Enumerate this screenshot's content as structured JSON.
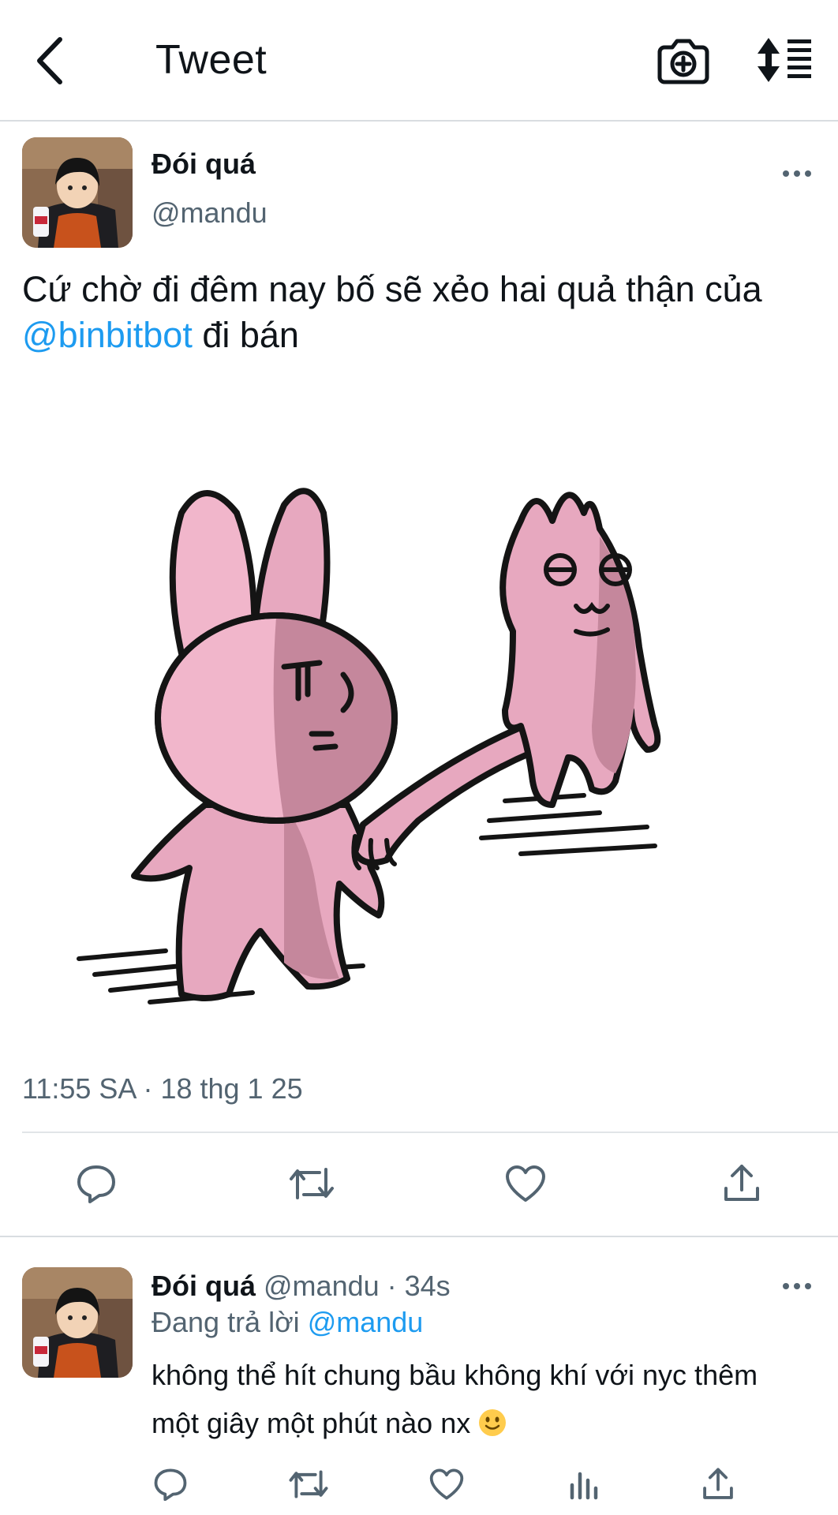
{
  "header": {
    "back_icon": "chevron-left-icon",
    "title": "Tweet",
    "camera_icon": "camera-plus-icon",
    "sort_icon": "sort-list-icon"
  },
  "tweet": {
    "author_name": "Đói quá",
    "handle": "@mandu",
    "text_before": "Cứ chờ đi đêm nay bố sẽ xẻo hai quả thận của ",
    "mention": "@binbitbot",
    "text_after": " đi bán",
    "timestamp": "11:55 SA · 18 thg 1 25",
    "actions": [
      "reply-icon",
      "retweet-icon",
      "like-icon",
      "share-icon"
    ]
  },
  "reply": {
    "author_name": "Đói quá",
    "handle_time": "@mandu · 34s",
    "replying_label": "Đang trả lời ",
    "replying_to": "@mandu",
    "text": "không thể hít chung bầu không khí với nyc thêm một giây một phút nào nx",
    "emoji": "slightly-smiling-face-emoji",
    "actions": [
      "reply-icon",
      "retweet-icon",
      "like-icon",
      "analytics-icon",
      "share-icon"
    ]
  },
  "colors": {
    "link": "#1d9bf0",
    "secondary_text": "#536471",
    "primary_text": "#0f1419",
    "divider": "#e1e5e8"
  }
}
